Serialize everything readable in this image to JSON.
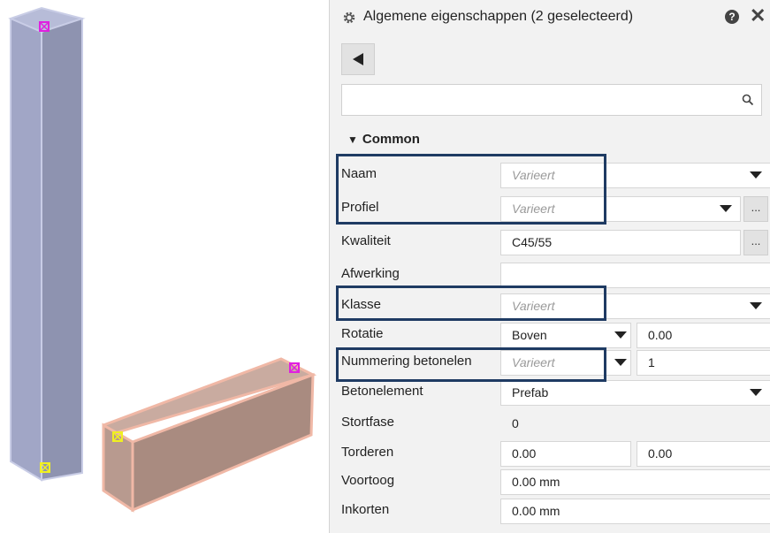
{
  "panel": {
    "title": "Algemene eigenschappen (2 geselecteerd)",
    "help_icon": "?",
    "close_icon": "✕",
    "search": {
      "value": "",
      "placeholder": ""
    },
    "group_label": "Common",
    "properties": {
      "naam": {
        "label": "Naam",
        "value": "Varieert"
      },
      "profiel": {
        "label": "Profiel",
        "value": "Varieert"
      },
      "kwaliteit": {
        "label": "Kwaliteit",
        "value": "C45/55"
      },
      "afwerking": {
        "label": "Afwerking",
        "value": ""
      },
      "klasse": {
        "label": "Klasse",
        "value": "Varieert"
      },
      "rotatie": {
        "label": "Rotatie",
        "value": "Boven",
        "value2": "0.00"
      },
      "nummering": {
        "label": "Nummering betonelen",
        "value": "Varieert",
        "value2": "1"
      },
      "betonelement": {
        "label": "Betonelement",
        "value": "Prefab"
      },
      "stortfase": {
        "label": "Stortfase",
        "value": "0"
      },
      "torderen": {
        "label": "Torderen",
        "value": "0.00",
        "value2": "0.00"
      },
      "voortoog": {
        "label": "Voortoog",
        "value": "0.00 mm"
      },
      "inkorten": {
        "label": "Inkorten",
        "value": "0.00 mm"
      }
    },
    "ellipsis": "..."
  },
  "colors": {
    "highlight_border": "#1f3b63",
    "column_fill": "#9aa0bf",
    "beam_fill": "#b89a8f",
    "handle_magenta": "#e020e0",
    "handle_yellow": "#f0f020"
  },
  "icons": {
    "title": "gear-icon",
    "help": "help-icon",
    "close": "close-icon",
    "back": "back-arrow-icon",
    "search": "search-icon"
  }
}
